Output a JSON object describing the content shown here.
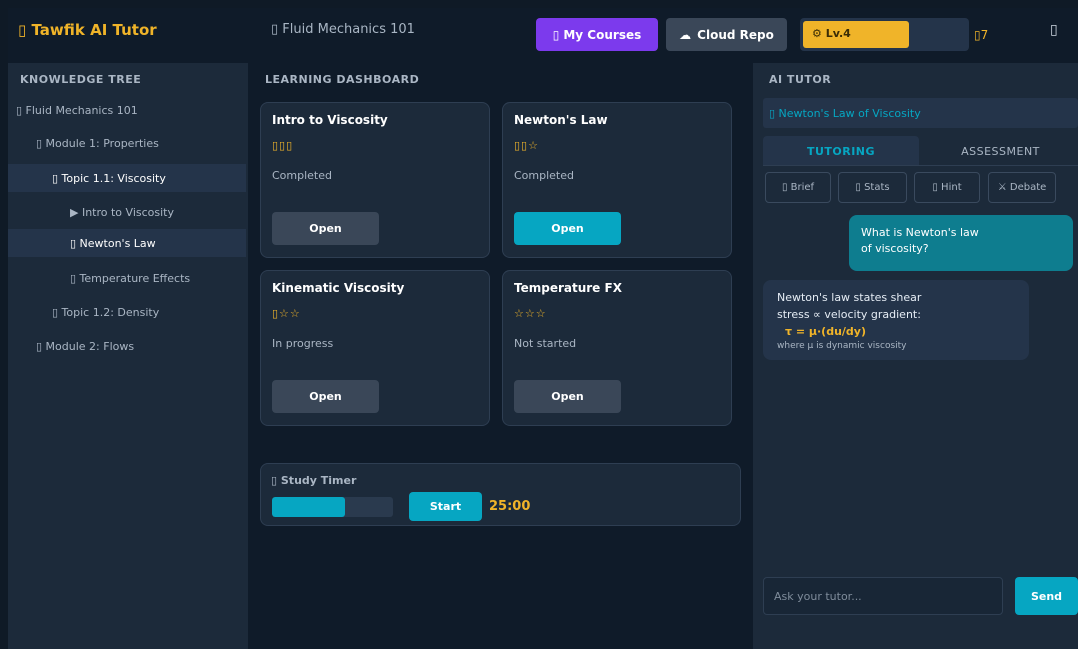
{
  "header": {
    "brand_icon": "▯",
    "brand": "Tawfik AI Tutor",
    "course_icon": "▯",
    "course": "Fluid Mechanics 101",
    "my_courses_icon": "▯",
    "my_courses": "My Courses",
    "cloud_icon": "☁",
    "cloud_repo": "Cloud Repo",
    "level_icon": "⚙",
    "level": "Lv.4",
    "level_progress_percent": 65,
    "streak_icon": "▯",
    "streak": "7",
    "menu_icon": "▯"
  },
  "sidebar": {
    "title": "KNOWLEDGE TREE",
    "items": [
      {
        "label": "▯ Fluid Mechanics 101"
      },
      {
        "label": "▯ Module 1: Properties"
      },
      {
        "label": "▯ Topic 1.1: Viscosity"
      },
      {
        "label": "▶ Intro to Viscosity"
      },
      {
        "label": "▯ Newton's Law"
      },
      {
        "label": "▯ Temperature Effects"
      },
      {
        "label": "▯ Topic 1.2: Density"
      },
      {
        "label": "▯ Module 2: Flows"
      }
    ]
  },
  "dashboard": {
    "title": "LEARNING DASHBOARD",
    "cards": [
      {
        "title": "Intro to Viscosity",
        "stars": "▯▯▯",
        "status": "Completed",
        "button": "Open"
      },
      {
        "title": "Newton's Law",
        "stars": "▯▯☆",
        "status": "Completed",
        "button": "Open"
      },
      {
        "title": "Kinematic Viscosity",
        "stars": "▯☆☆",
        "status": "In progress",
        "button": "Open"
      },
      {
        "title": "Temperature FX",
        "stars": "☆☆☆",
        "status": "Not started",
        "button": "Open"
      }
    ],
    "timer": {
      "label": "▯ Study Timer",
      "progress_percent": 60,
      "start": "Start",
      "time": "25:00"
    }
  },
  "tutor": {
    "title": "AI TUTOR",
    "topic": "▯ Newton's Law of Viscosity",
    "tabs": {
      "tutoring": "TUTORING",
      "assessment": "ASSESSMENT"
    },
    "tools": {
      "brief": "▯ Brief",
      "stats": "▯ Stats",
      "hint": "▯ Hint",
      "debate": "⚔ Debate"
    },
    "messages": {
      "user_line1": "What is Newton's law",
      "user_line2": "of viscosity?",
      "ai_line1": "Newton's law states shear",
      "ai_line2": "stress ∝ velocity gradient:",
      "ai_formula": "τ = μ·(du/dy)",
      "ai_note": "where μ is dynamic viscosity"
    },
    "input_placeholder": "Ask your tutor...",
    "send": "Send"
  },
  "colors": {
    "accent_gold": "#f0b429",
    "accent_cyan": "#06a6c2",
    "accent_purple": "#7c3aed",
    "panel": "#1c2a3a",
    "background": "#0f1b29"
  }
}
